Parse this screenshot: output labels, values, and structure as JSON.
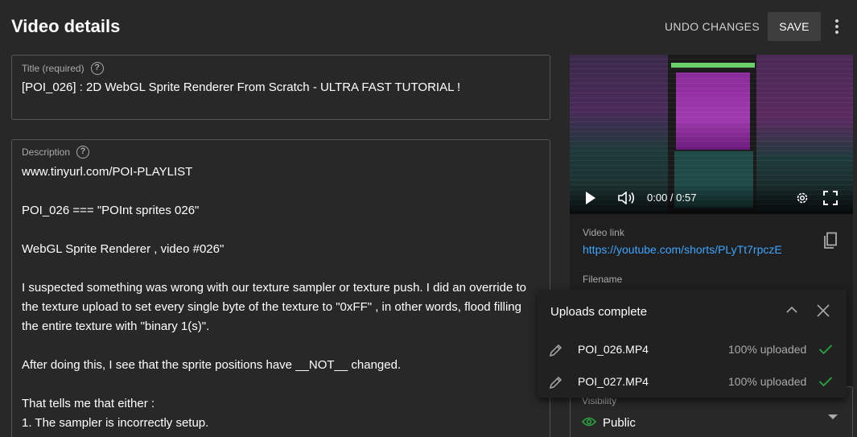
{
  "header": {
    "title": "Video details",
    "undo_label": "UNDO CHANGES",
    "save_label": "SAVE"
  },
  "title_field": {
    "label": "Title (required)",
    "value": "[POI_026] : 2D WebGL Sprite Renderer From Scratch - ULTRA FAST TUTORIAL !"
  },
  "description_field": {
    "label": "Description",
    "lines": [
      "www.tinyurl.com/POI-PLAYLIST",
      "",
      "POI_026 === \"POInt sprites 026\"",
      "",
      "WebGL Sprite Renderer , video #026\"",
      "",
      "I suspected something was wrong with our texture sampler or texture push. I did an override to",
      "the texture upload to set every single byte of the texture to \"0xFF\" , in other words, flood filling",
      "the entire texture with \"binary 1(s)\".",
      "",
      "After doing this, I see that the sprite positions have __NOT__ changed.",
      "",
      "That tells me that either :",
      "1. The sampler is incorrectly setup."
    ]
  },
  "player": {
    "time": "0:00 / 0:57"
  },
  "video_info": {
    "link_label": "Video link",
    "link_value": "https://youtube.com/shorts/PLyTt7rpczE",
    "filename_label": "Filename"
  },
  "visibility": {
    "label": "Visibility",
    "value": "Public"
  },
  "uploads": {
    "title": "Uploads complete",
    "items": [
      {
        "name": "POI_026.MP4",
        "status": "100% uploaded"
      },
      {
        "name": "POI_027.MP4",
        "status": "100% uploaded"
      }
    ]
  },
  "colors": {
    "background": "#282828",
    "link": "#3ea6ff",
    "success": "#2ba640",
    "visibility_icon": "#2ba640"
  },
  "icons": [
    "help-icon",
    "more-vert-icon",
    "play-icon",
    "volume-icon",
    "settings-icon",
    "fullscreen-icon",
    "copy-icon",
    "pencil-icon",
    "check-icon",
    "collapse-icon",
    "close-icon",
    "eye-icon",
    "caret-down-icon"
  ]
}
